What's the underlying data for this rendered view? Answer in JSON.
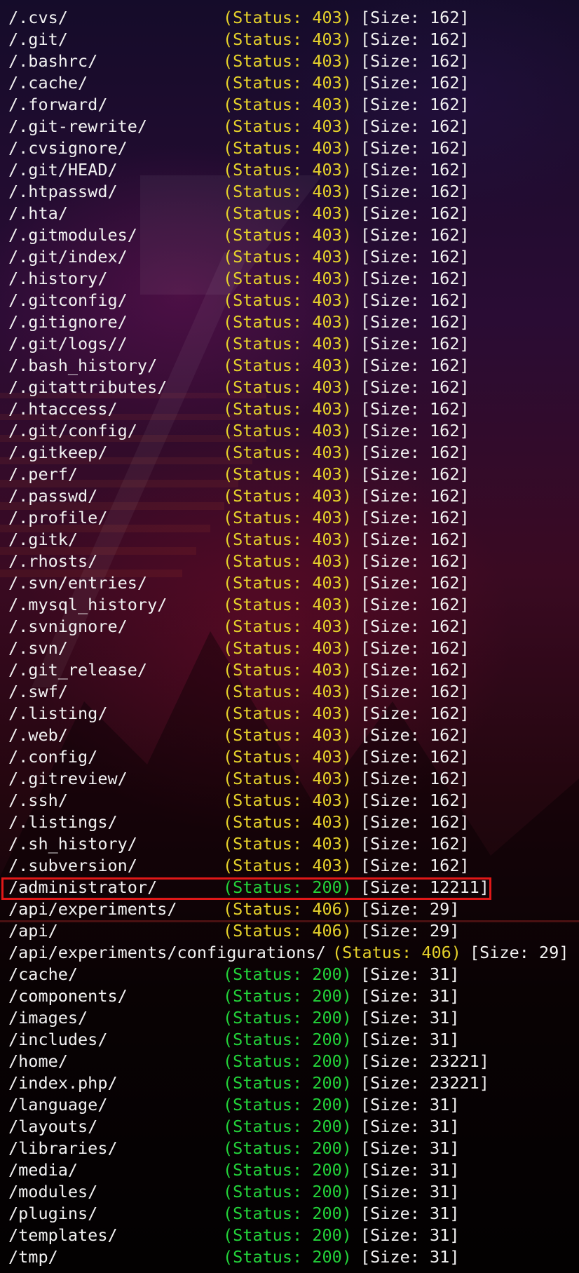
{
  "theme": {
    "status_403_color": "#e6d22b",
    "status_406_color": "#e6d22b",
    "status_200_color": "#23d33a",
    "text_color": "#f2f2f2",
    "highlight_color": "#e01818"
  },
  "highlighted_entry": "/administrator/",
  "lines": [
    {
      "path": "/.cvs/",
      "status": "(Status: 403)",
      "size": "[Size: 162]",
      "color": "yellow"
    },
    {
      "path": "/.git/",
      "status": "(Status: 403)",
      "size": "[Size: 162]",
      "color": "yellow"
    },
    {
      "path": "/.bashrc/",
      "status": "(Status: 403)",
      "size": "[Size: 162]",
      "color": "yellow"
    },
    {
      "path": "/.cache/",
      "status": "(Status: 403)",
      "size": "[Size: 162]",
      "color": "yellow"
    },
    {
      "path": "/.forward/",
      "status": "(Status: 403)",
      "size": "[Size: 162]",
      "color": "yellow"
    },
    {
      "path": "/.git-rewrite/",
      "status": "(Status: 403)",
      "size": "[Size: 162]",
      "color": "yellow"
    },
    {
      "path": "/.cvsignore/",
      "status": "(Status: 403)",
      "size": "[Size: 162]",
      "color": "yellow"
    },
    {
      "path": "/.git/HEAD/",
      "status": "(Status: 403)",
      "size": "[Size: 162]",
      "color": "yellow"
    },
    {
      "path": "/.htpasswd/",
      "status": "(Status: 403)",
      "size": "[Size: 162]",
      "color": "yellow"
    },
    {
      "path": "/.hta/",
      "status": "(Status: 403)",
      "size": "[Size: 162]",
      "color": "yellow"
    },
    {
      "path": "/.gitmodules/",
      "status": "(Status: 403)",
      "size": "[Size: 162]",
      "color": "yellow"
    },
    {
      "path": "/.git/index/",
      "status": "(Status: 403)",
      "size": "[Size: 162]",
      "color": "yellow"
    },
    {
      "path": "/.history/",
      "status": "(Status: 403)",
      "size": "[Size: 162]",
      "color": "yellow"
    },
    {
      "path": "/.gitconfig/",
      "status": "(Status: 403)",
      "size": "[Size: 162]",
      "color": "yellow"
    },
    {
      "path": "/.gitignore/",
      "status": "(Status: 403)",
      "size": "[Size: 162]",
      "color": "yellow"
    },
    {
      "path": "/.git/logs//",
      "status": "(Status: 403)",
      "size": "[Size: 162]",
      "color": "yellow"
    },
    {
      "path": "/.bash_history/",
      "status": "(Status: 403)",
      "size": "[Size: 162]",
      "color": "yellow"
    },
    {
      "path": "/.gitattributes/",
      "status": "(Status: 403)",
      "size": "[Size: 162]",
      "color": "yellow"
    },
    {
      "path": "/.htaccess/",
      "status": "(Status: 403)",
      "size": "[Size: 162]",
      "color": "yellow"
    },
    {
      "path": "/.git/config/",
      "status": "(Status: 403)",
      "size": "[Size: 162]",
      "color": "yellow"
    },
    {
      "path": "/.gitkeep/",
      "status": "(Status: 403)",
      "size": "[Size: 162]",
      "color": "yellow"
    },
    {
      "path": "/.perf/",
      "status": "(Status: 403)",
      "size": "[Size: 162]",
      "color": "yellow"
    },
    {
      "path": "/.passwd/",
      "status": "(Status: 403)",
      "size": "[Size: 162]",
      "color": "yellow"
    },
    {
      "path": "/.profile/",
      "status": "(Status: 403)",
      "size": "[Size: 162]",
      "color": "yellow"
    },
    {
      "path": "/.gitk/",
      "status": "(Status: 403)",
      "size": "[Size: 162]",
      "color": "yellow"
    },
    {
      "path": "/.rhosts/",
      "status": "(Status: 403)",
      "size": "[Size: 162]",
      "color": "yellow"
    },
    {
      "path": "/.svn/entries/",
      "status": "(Status: 403)",
      "size": "[Size: 162]",
      "color": "yellow"
    },
    {
      "path": "/.mysql_history/",
      "status": "(Status: 403)",
      "size": "[Size: 162]",
      "color": "yellow"
    },
    {
      "path": "/.svnignore/",
      "status": "(Status: 403)",
      "size": "[Size: 162]",
      "color": "yellow"
    },
    {
      "path": "/.svn/",
      "status": "(Status: 403)",
      "size": "[Size: 162]",
      "color": "yellow"
    },
    {
      "path": "/.git_release/",
      "status": "(Status: 403)",
      "size": "[Size: 162]",
      "color": "yellow"
    },
    {
      "path": "/.swf/",
      "status": "(Status: 403)",
      "size": "[Size: 162]",
      "color": "yellow"
    },
    {
      "path": "/.listing/",
      "status": "(Status: 403)",
      "size": "[Size: 162]",
      "color": "yellow"
    },
    {
      "path": "/.web/",
      "status": "(Status: 403)",
      "size": "[Size: 162]",
      "color": "yellow"
    },
    {
      "path": "/.config/",
      "status": "(Status: 403)",
      "size": "[Size: 162]",
      "color": "yellow"
    },
    {
      "path": "/.gitreview/",
      "status": "(Status: 403)",
      "size": "[Size: 162]",
      "color": "yellow"
    },
    {
      "path": "/.ssh/",
      "status": "(Status: 403)",
      "size": "[Size: 162]",
      "color": "yellow"
    },
    {
      "path": "/.listings/",
      "status": "(Status: 403)",
      "size": "[Size: 162]",
      "color": "yellow"
    },
    {
      "path": "/.sh_history/",
      "status": "(Status: 403)",
      "size": "[Size: 162]",
      "color": "yellow"
    },
    {
      "path": "/.subversion/",
      "status": "(Status: 403)",
      "size": "[Size: 162]",
      "color": "yellow"
    },
    {
      "path": "/administrator/",
      "status": "(Status: 200)",
      "size": "[Size: 12211]",
      "color": "green"
    },
    {
      "path": "/api/experiments/",
      "status": "(Status: 406)",
      "size": "[Size: 29]",
      "color": "yellow"
    },
    {
      "path": "/api/",
      "status": "(Status: 406)",
      "size": "[Size: 29]",
      "color": "yellow"
    },
    {
      "path": "/api/experiments/configurations/",
      "status": "(Status: 406)",
      "size": "[Size: 29]",
      "color": "yellow"
    },
    {
      "path": "/cache/",
      "status": "(Status: 200)",
      "size": "[Size: 31]",
      "color": "green"
    },
    {
      "path": "/components/",
      "status": "(Status: 200)",
      "size": "[Size: 31]",
      "color": "green"
    },
    {
      "path": "/images/",
      "status": "(Status: 200)",
      "size": "[Size: 31]",
      "color": "green"
    },
    {
      "path": "/includes/",
      "status": "(Status: 200)",
      "size": "[Size: 31]",
      "color": "green"
    },
    {
      "path": "/home/",
      "status": "(Status: 200)",
      "size": "[Size: 23221]",
      "color": "green"
    },
    {
      "path": "/index.php/",
      "status": "(Status: 200)",
      "size": "[Size: 23221]",
      "color": "green"
    },
    {
      "path": "/language/",
      "status": "(Status: 200)",
      "size": "[Size: 31]",
      "color": "green"
    },
    {
      "path": "/layouts/",
      "status": "(Status: 200)",
      "size": "[Size: 31]",
      "color": "green"
    },
    {
      "path": "/libraries/",
      "status": "(Status: 200)",
      "size": "[Size: 31]",
      "color": "green"
    },
    {
      "path": "/media/",
      "status": "(Status: 200)",
      "size": "[Size: 31]",
      "color": "green"
    },
    {
      "path": "/modules/",
      "status": "(Status: 200)",
      "size": "[Size: 31]",
      "color": "green"
    },
    {
      "path": "/plugins/",
      "status": "(Status: 200)",
      "size": "[Size: 31]",
      "color": "green"
    },
    {
      "path": "/templates/",
      "status": "(Status: 200)",
      "size": "[Size: 31]",
      "color": "green"
    },
    {
      "path": "/tmp/",
      "status": "(Status: 200)",
      "size": "[Size: 31]",
      "color": "green"
    }
  ]
}
